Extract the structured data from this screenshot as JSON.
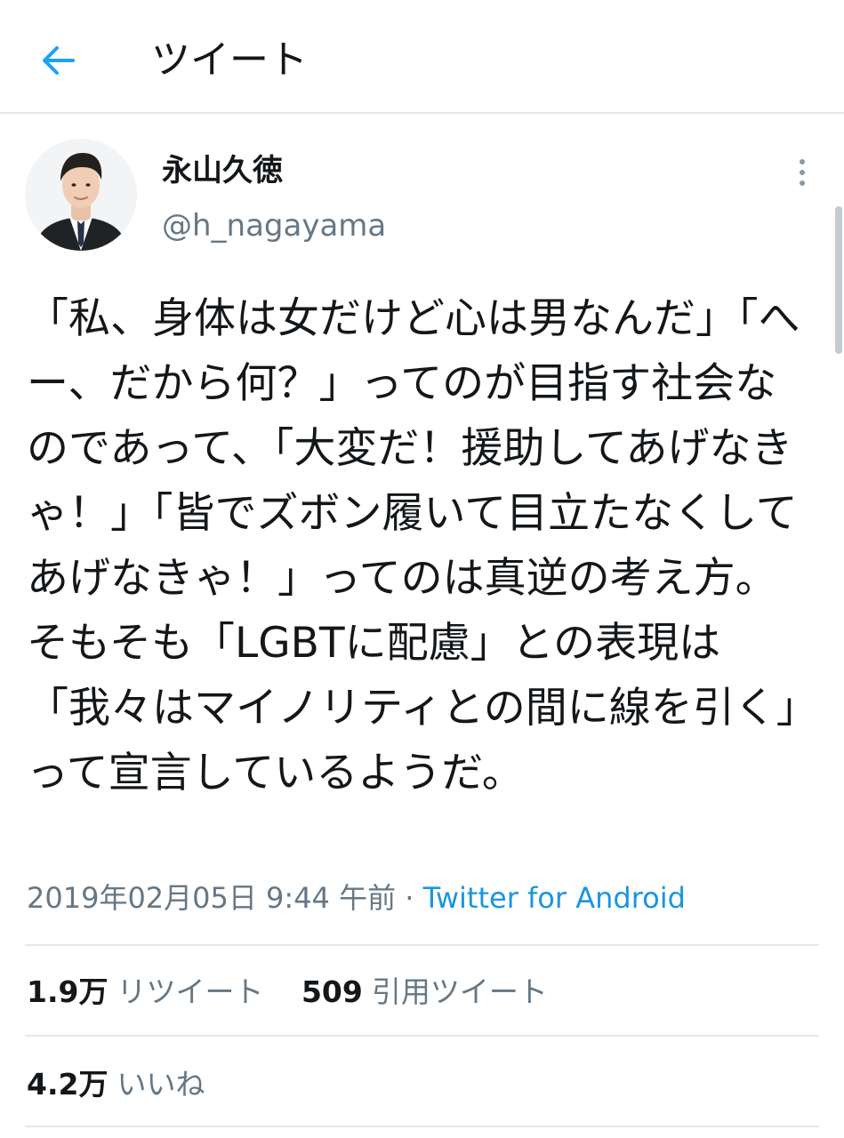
{
  "header": {
    "title": "ツイート",
    "back_icon": "arrow-left-icon",
    "accent_color": "#1da1f2"
  },
  "tweet": {
    "author": {
      "display_name": "永山久徳",
      "handle": "@h_nagayama"
    },
    "text": "「私、身体は女だけど心は男なんだ」「へー、だから何？」ってのが目指す社会なのであって、「大変だ！援助してあげなきゃ！」「皆でズボン履いて目立たなくしてあげなきゃ！」ってのは真逆の考え方。そもそも「LGBTに配慮」との表現は「我々はマイノリティとの間に線を引く」って宣言しているようだ。",
    "timestamp": "2019年02月05日 9:44 午前",
    "separator": "·",
    "source": "Twitter for Android"
  },
  "stats": {
    "retweets": {
      "count": "1.9万",
      "label": "リツイート"
    },
    "quotes": {
      "count": "509",
      "label": "引用ツイート"
    },
    "likes": {
      "count": "4.2万",
      "label": "いいね"
    }
  },
  "colors": {
    "text": "#14171a",
    "secondary": "#657786",
    "link": "#1b95e0",
    "divider": "#e1e8ed"
  }
}
